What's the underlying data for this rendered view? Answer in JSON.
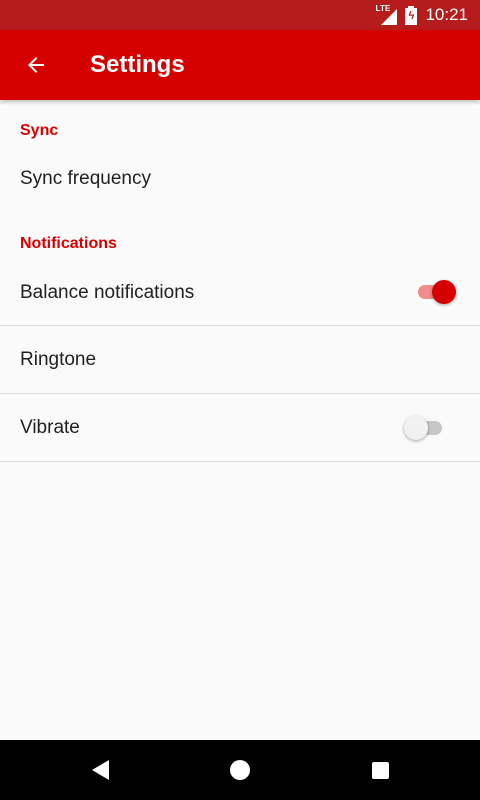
{
  "status_bar": {
    "network_label": "LTE",
    "time": "10:21",
    "battery_icon": "battery-charging-icon",
    "signal_icon": "signal-icon"
  },
  "app_bar": {
    "title": "Settings",
    "back_icon": "arrow-back-icon",
    "color": "#d50000"
  },
  "sections": {
    "sync": {
      "header": "Sync",
      "items": [
        {
          "label": "Sync frequency"
        }
      ]
    },
    "notifications": {
      "header": "Notifications",
      "items": [
        {
          "label": "Balance notifications",
          "toggle": true
        },
        {
          "label": "Ringtone"
        },
        {
          "label": "Vibrate",
          "toggle": false
        }
      ]
    }
  },
  "nav_bar": {
    "back_icon": "nav-back-icon",
    "home_icon": "nav-home-icon",
    "recents_icon": "nav-recents-icon"
  },
  "colors": {
    "status_bar": "#b71c1c",
    "accent": "#d50000"
  }
}
